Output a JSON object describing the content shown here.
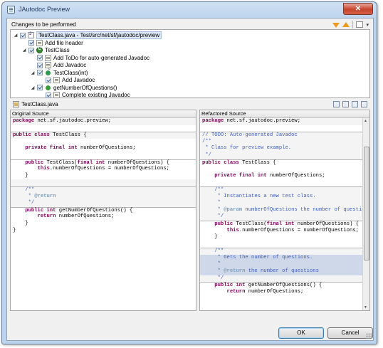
{
  "window": {
    "title": "JAutodoc Preview",
    "close_label": "✕"
  },
  "changes": {
    "header": "Changes to be performed",
    "items": [
      {
        "label": "TestClass.java - Test/src/net/sf/jautodoc/preview",
        "checked": true,
        "level": 0,
        "expanded": true,
        "icon": "java-file-icon"
      },
      {
        "label": "Add file header",
        "checked": true,
        "level": 1,
        "icon": "doc-icon"
      },
      {
        "label": "TestClass",
        "checked": true,
        "level": 1,
        "expanded": true,
        "icon": "class-icon"
      },
      {
        "label": "Add ToDo for auto-generated Javadoc",
        "checked": true,
        "level": 2,
        "icon": "doc-icon"
      },
      {
        "label": "Add Javadoc",
        "checked": true,
        "level": 2,
        "icon": "doc-icon"
      },
      {
        "label": "TestClass(int)",
        "checked": true,
        "level": 2,
        "expanded": true,
        "icon": "constructor-icon"
      },
      {
        "label": "Add Javadoc",
        "checked": true,
        "level": 3,
        "icon": "doc-icon"
      },
      {
        "label": "getNumberOfQuestions()",
        "checked": true,
        "level": 2,
        "expanded": true,
        "icon": "method-icon"
      },
      {
        "label": "Complete existing Javadoc",
        "checked": true,
        "level": 3,
        "icon": "doc-icon"
      }
    ]
  },
  "compare": {
    "file_label": "TestClass.java"
  },
  "original": {
    "header": "Original Source",
    "lines": [
      "package net.sf.jautodoc.preview;",
      "",
      "public class TestClass {",
      "",
      "    private final int numberOfQuestions;",
      "",
      "    public TestClass(final int numberOfQuestions) {",
      "        this.numberOfQuestions = numberOfQuestions;",
      "    }",
      "",
      "    /**",
      "     * @return",
      "     */",
      "    public int getNumberOfQuestions() {",
      "        return numberOfQuestions;",
      "    }",
      "}"
    ]
  },
  "refactored": {
    "header": "Refactored Source",
    "lines": [
      "package net.sf.jautodoc.preview;",
      "",
      "// TODO: Auto-generated Javadoc",
      "/**",
      " * Class for preview example.",
      " */",
      "public class TestClass {",
      "",
      "    private final int numberOfQuestions;",
      "",
      "    /**",
      "     * Instantiates a new test class.",
      "     *",
      "     * @param numberOfQuestions the number of questions",
      "     */",
      "    public TestClass(final int numberOfQuestions) {",
      "        this.numberOfQuestions = numberOfQuestions;",
      "    }",
      "",
      "    /**",
      "     * Gets the number of questions.",
      "     *",
      "     * @return the number of questions",
      "     */",
      "    public int getNumberOfQuestions() {",
      "        return numberOfQuestions;"
    ]
  },
  "buttons": {
    "ok": "OK",
    "cancel": "Cancel"
  }
}
